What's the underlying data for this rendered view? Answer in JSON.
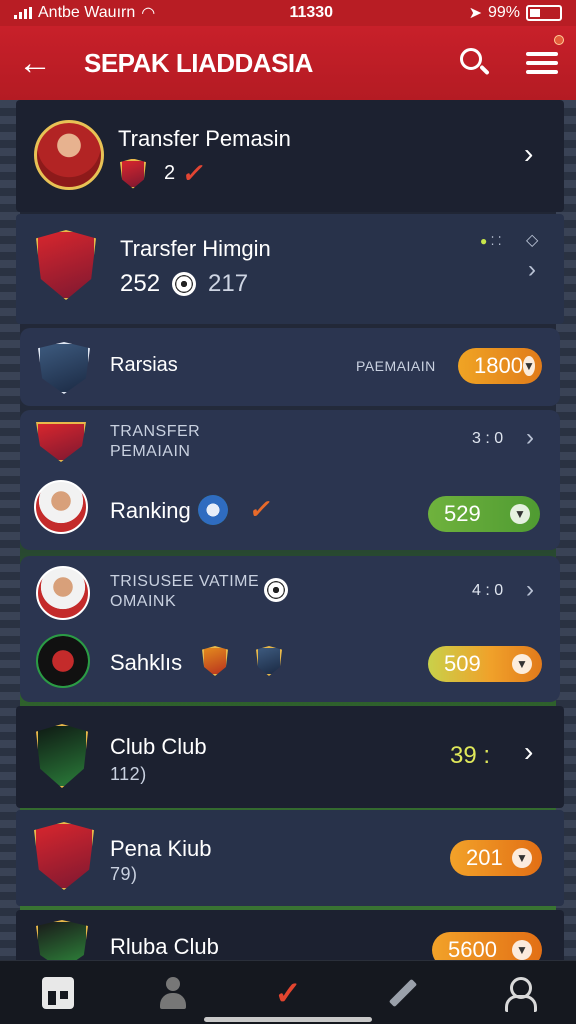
{
  "status_bar": {
    "carrier": "Antbe Wauırn",
    "time": "11330",
    "battery": "99%"
  },
  "app_bar": {
    "title": "SEPAK LIADDASIA"
  },
  "items": [
    {
      "title": "Transfer Pemasin",
      "stat": "2"
    },
    {
      "title": "Trarsfer Himgin",
      "stat_a": "252",
      "stat_b": "217"
    },
    {
      "title": "Rarsias",
      "label": "PAEMAIAIN",
      "pill": "1800"
    },
    {
      "title": "TRANSFER PEMAIAIN",
      "score": "3 : 0",
      "sub": "Ranking",
      "pill": "529"
    },
    {
      "title": "TRISUSEE VATIME OMAINK",
      "score": "4 : 0",
      "sub": "Sahklıs",
      "pill": "509"
    },
    {
      "title": "Club Club",
      "sub": "112)",
      "score": "39 :"
    },
    {
      "title": "Pena Kiub",
      "sub": "79)",
      "pill": "201"
    },
    {
      "title": "Rluba Club",
      "pill": "5600"
    }
  ],
  "colors": {
    "brand_red": "#c8202a",
    "pill_orange": "#e07b1a",
    "pill_green": "#4f9b32"
  },
  "nav": [
    "home-icon",
    "user-icon",
    "check-icon",
    "edit-icon",
    "profile-icon"
  ]
}
